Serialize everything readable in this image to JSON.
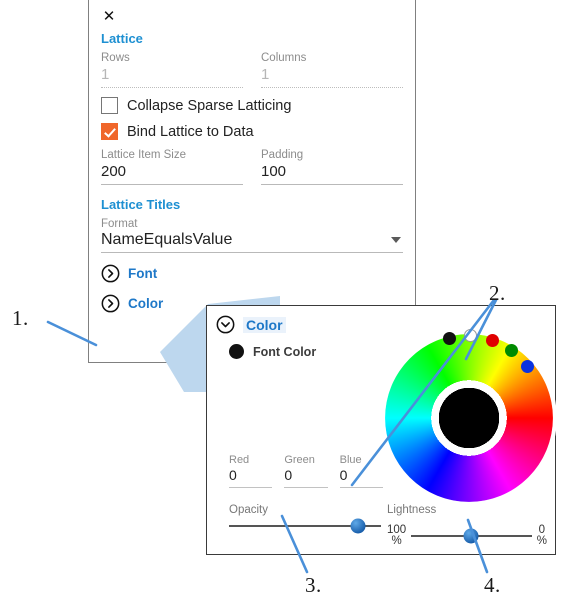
{
  "lattice_panel": {
    "close_icon": "close-icon",
    "section_title": "Lattice",
    "rows": {
      "label": "Rows",
      "value": "1"
    },
    "columns": {
      "label": "Columns",
      "value": "1"
    },
    "collapse_sparse": {
      "label": "Collapse Sparse Latticing",
      "checked": false
    },
    "bind_lattice": {
      "label": "Bind Lattice to Data",
      "checked": true
    },
    "item_size": {
      "label": "Lattice Item Size",
      "value": "200"
    },
    "padding": {
      "label": "Padding",
      "value": "100"
    },
    "titles_title": "Lattice Titles",
    "format": {
      "label": "Format",
      "value": "NameEqualsValue"
    },
    "font_expander": "Font",
    "color_expander": "Color"
  },
  "color_panel": {
    "header": "Color",
    "font_color_label": "Font Color",
    "font_color_swatch": "#111111",
    "red": {
      "label": "Red",
      "value": "0"
    },
    "green": {
      "label": "Green",
      "value": "0"
    },
    "blue": {
      "label": "Blue",
      "value": "0"
    },
    "opacity": {
      "label": "Opacity",
      "position_pct": 85
    },
    "lightness": {
      "label": "Lightness",
      "min_label": "100",
      "min_unit": "%",
      "max_label": "0",
      "max_unit": "%",
      "position_pct": 50
    },
    "swatches": [
      {
        "name": "swatch-black",
        "color": "#111111"
      },
      {
        "name": "swatch-white",
        "color": "#ffffff"
      },
      {
        "name": "swatch-red",
        "color": "#e00000"
      },
      {
        "name": "swatch-green",
        "color": "#008a00"
      },
      {
        "name": "swatch-blue",
        "color": "#0a32e0"
      }
    ]
  },
  "callouts": {
    "one": "1.",
    "two": "2.",
    "three": "3.",
    "four": "4."
  },
  "colors": {
    "accent_blue": "#1e90d2",
    "link_blue": "#1e78c8",
    "checkbox_orange": "#f0662a",
    "leader_line": "#4a90d9",
    "connector_fill": "#bdd7ee"
  }
}
